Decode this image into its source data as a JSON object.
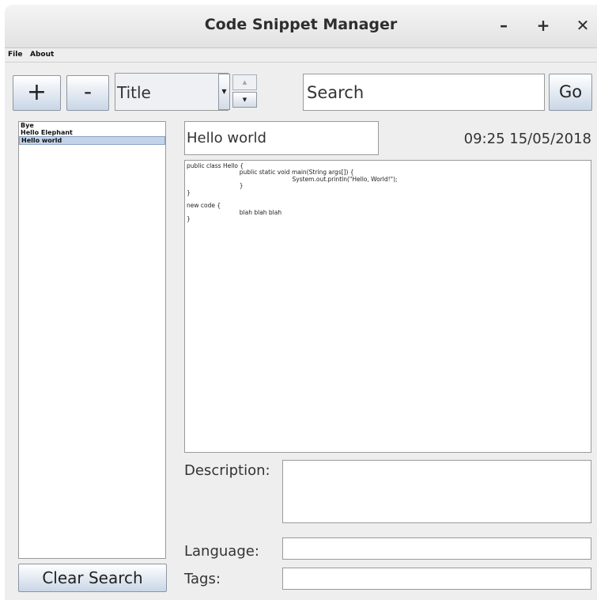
{
  "window": {
    "title": "Code Snippet Manager",
    "minimize": "–",
    "maximize": "+",
    "close": "✕"
  },
  "menubar": {
    "items": [
      "File",
      "About"
    ]
  },
  "toolbar": {
    "add_label": "+",
    "remove_label": "-",
    "sort_selected": "Title",
    "spin_up": "▲",
    "spin_down": "▼",
    "search_value": "Search",
    "go_label": "Go"
  },
  "snippets": {
    "items": [
      "Bye",
      "Hello Elephant",
      "Hello world"
    ],
    "selected_index": 2
  },
  "detail": {
    "title_value": "Hello world",
    "timestamp": "09:25 15/05/2018",
    "code": "public class Hello {\n\t\tpublic static void main(String args[]) {\n\t\t\t\tSystem.out.println(\"Hello, World!\");\n\t\t}\n}\n\nnew code {\n\t\tblah blah blah\n}",
    "description_label": "Description:",
    "description_value": "",
    "language_label": "Language:",
    "language_value": "",
    "tags_label": "Tags:",
    "tags_value": ""
  },
  "clear_search_label": "Clear Search"
}
